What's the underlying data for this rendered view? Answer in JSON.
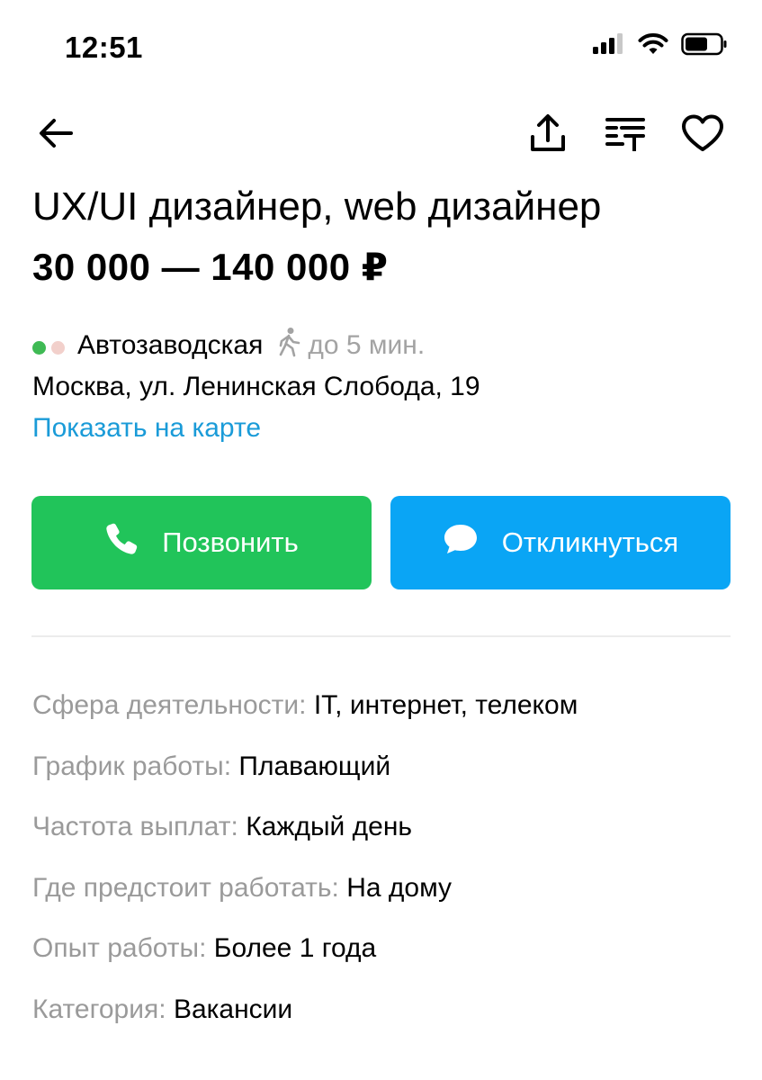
{
  "status_bar": {
    "time": "12:51"
  },
  "colors": {
    "accent_link": "#1a9bd8",
    "call_button": "#21c45a",
    "respond_button": "#0aa5f5",
    "metro_dot_1": "#3fba54",
    "metro_dot_2": "#f2d0cb"
  },
  "nav": {
    "back_icon": "arrow-left-icon",
    "share_icon": "share-icon",
    "compare_icon": "list-add-icon",
    "favorite_icon": "heart-icon"
  },
  "vacancy": {
    "title": "UX/UI дизайнер, web дизайнер",
    "salary": "30 000 — 140 000 ₽"
  },
  "location": {
    "metro_station": "Автозаводская",
    "walk_time": "до 5 мин.",
    "address": "Москва, ул. Ленинская Слобода, 19",
    "map_link": "Показать на карте"
  },
  "actions": {
    "call_label": "Позвонить",
    "respond_label": "Откликнуться"
  },
  "details": [
    {
      "key": "Сфера деятельности:",
      "value": "IT, интернет, телеком"
    },
    {
      "key": "График работы:",
      "value": "Плавающий"
    },
    {
      "key": "Частота выплат:",
      "value": "Каждый день"
    },
    {
      "key": "Где предстоит работать:",
      "value": "На дому"
    },
    {
      "key": "Опыт работы:",
      "value": "Более 1 года"
    },
    {
      "key": "Категория:",
      "value": "Вакансии"
    }
  ]
}
